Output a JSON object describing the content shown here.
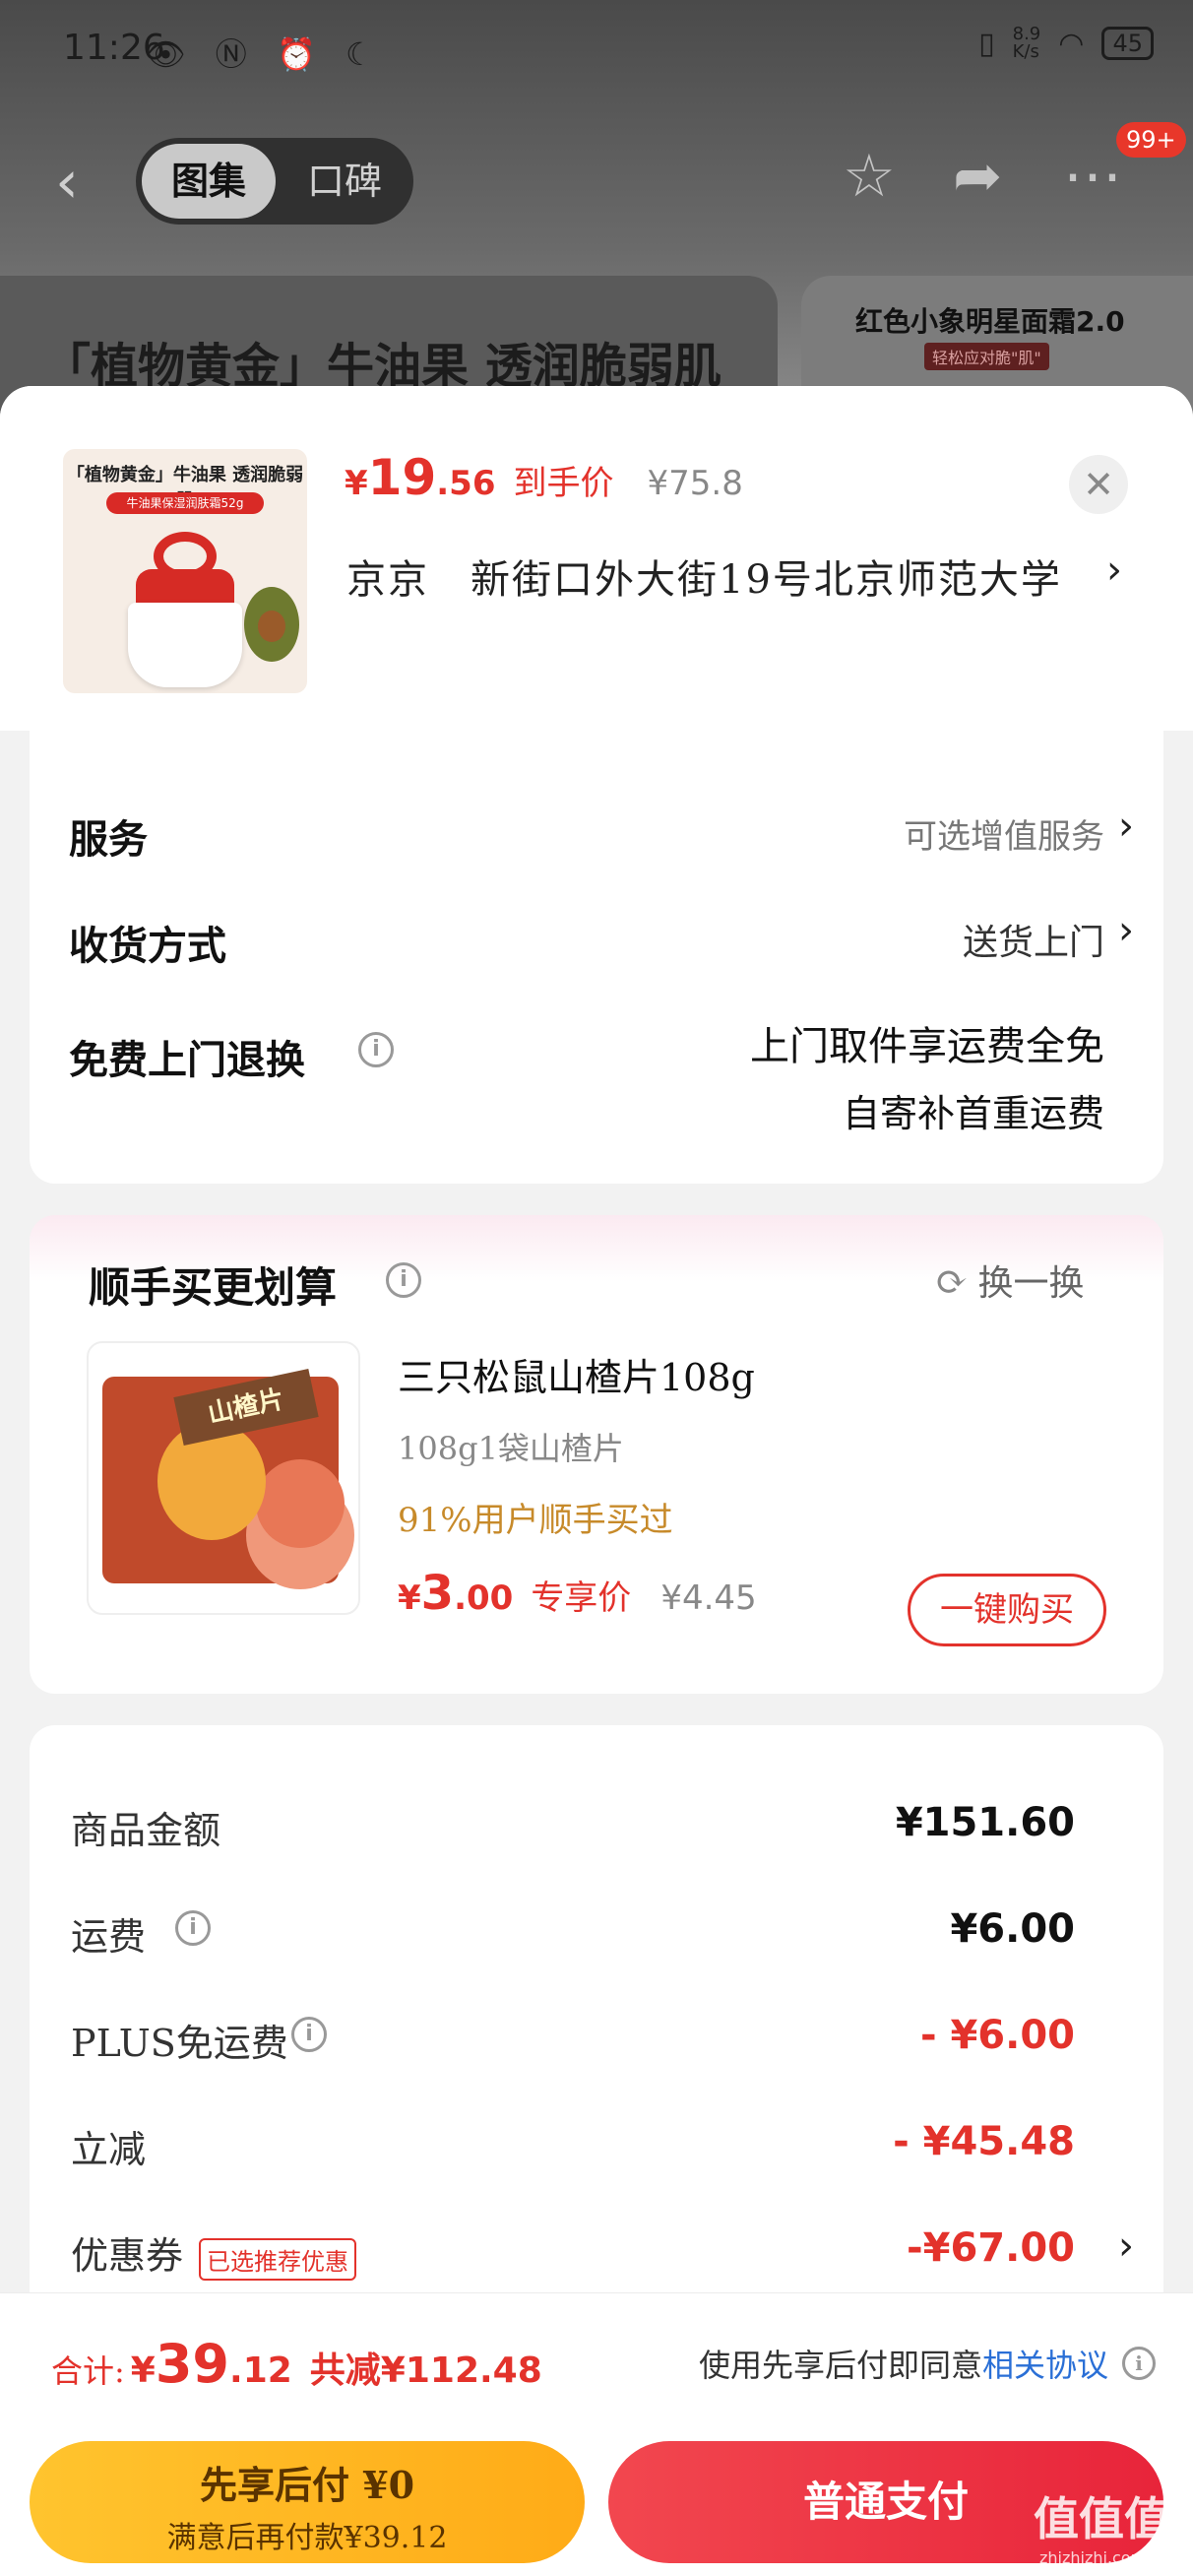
{
  "status_bar": {
    "time": "11:26",
    "left_icons": "👁 Ⓝ ⏰ ☾",
    "net_speed": "8.9\nK/s",
    "battery": "45"
  },
  "nav": {
    "tab_gallery": "图集",
    "tab_reviews": "口碑",
    "badge": "99+"
  },
  "background": {
    "product_title": "「植物黄金」牛油果 透润脆弱肌",
    "card2_title": "红色小象明星面霜2.0",
    "card2_sub": "轻松应对脆\"肌\""
  },
  "product": {
    "thumb_label": "「植物黄金」牛油果 透润脆弱肌",
    "thumb_sub": "牛油果保湿润肤霜52g",
    "price_currency": "¥",
    "price_int": "19",
    "price_dec": ".56",
    "price_label": "到手价",
    "orig_price": "¥75.8",
    "address": "京京　新街口外大街19号北京师范大学"
  },
  "service": {
    "service_label": "服务",
    "service_value": "可选增值服务",
    "delivery_label": "收货方式",
    "delivery_value": "送货上门",
    "return_label": "免费上门退换",
    "return_line1": "上门取件享运费全免",
    "return_line2": "自寄补首重运费"
  },
  "upsell": {
    "title": "顺手买更划算",
    "refresh": "换一换",
    "name": "三只松鼠山楂片108g",
    "spec": "108g1袋山楂片",
    "percent": "91%用户顺手买过",
    "price_currency": "¥",
    "price_int": "3",
    "price_dec": ".00",
    "price_label": "专享价",
    "orig_price": "¥4.45",
    "buy_label": "一键购买",
    "sign_text": "山楂片"
  },
  "summary": {
    "goods_label": "商品金额",
    "goods_value": "¥151.60",
    "freight_label": "运费",
    "freight_value": "¥6.00",
    "plus_label": "PLUS免运费",
    "plus_value": "- ¥6.00",
    "discount_label": "立减",
    "discount_value": "- ¥45.48",
    "coupon_label": "优惠券",
    "coupon_tag": "已选推荐优惠",
    "coupon_value": "-¥67.00"
  },
  "footer": {
    "total_label": "合计:",
    "total_currency": "¥",
    "total_int": "39",
    "total_dec": ".12",
    "total_saved": "共减¥112.48",
    "agree_text": "使用先享后付即同意",
    "agree_link": "相关协议",
    "pay_later_line1": "先享后付 ¥0",
    "pay_later_line2": "满意后再付款¥39.12",
    "pay_label": "普通支付"
  },
  "watermark": {
    "text": "值值值",
    "sub": "zhizhizhi.com"
  },
  "colors": {
    "accent_red": "#e3322b",
    "link_blue": "#2a6fd6",
    "pay_later_yellow": "#ffb81f"
  }
}
